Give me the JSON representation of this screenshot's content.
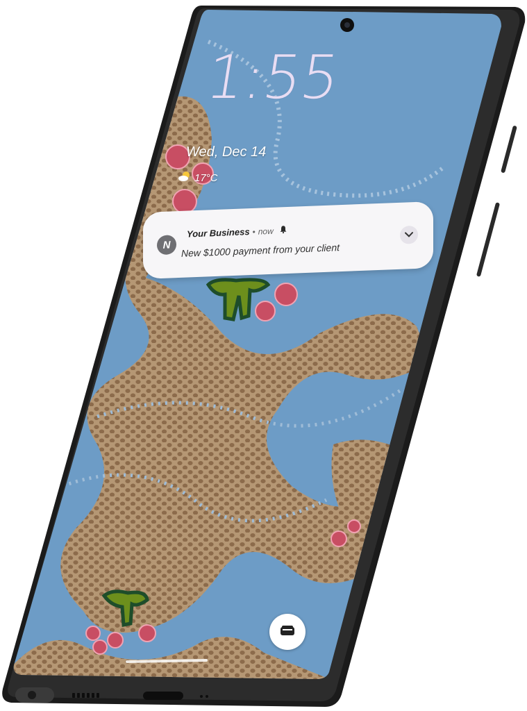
{
  "lockscreen": {
    "time": "1:55",
    "date": "Wed, Dec 14",
    "weather": {
      "temperature": "17°C",
      "icon": "partly-cloudy-icon"
    }
  },
  "notification": {
    "app_initial": "N",
    "app_name": "Your Business",
    "separator": "•",
    "time": "now",
    "alert_icon": "bell-icon",
    "message": "New $1000 payment from your client",
    "expand_icon": "chevron-down-icon"
  },
  "shortcuts": {
    "wallet_icon": "wallet-icon"
  },
  "colors": {
    "water": "#6d9cc6",
    "land": "#a58a6c",
    "phone_frame": "#1b1b1b",
    "notification_bg": "#f7f6f8",
    "clock": "#e8ddf3"
  }
}
